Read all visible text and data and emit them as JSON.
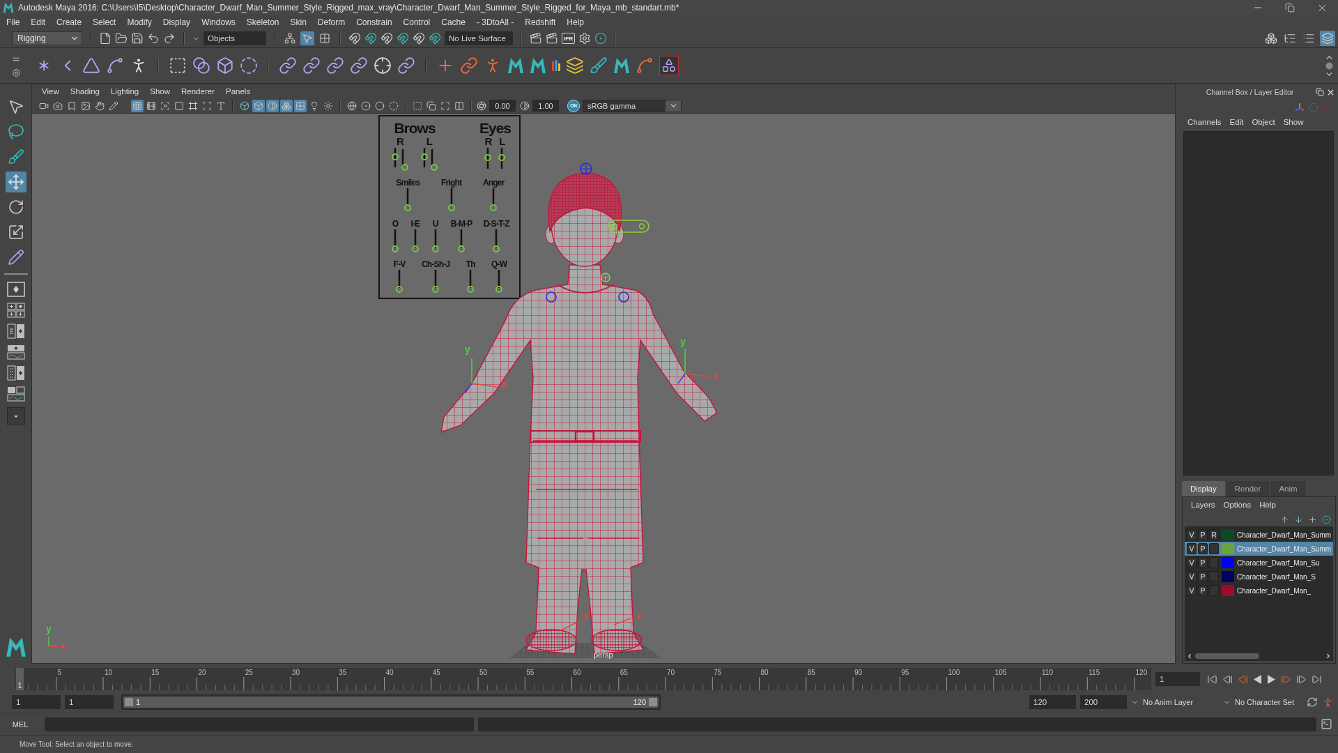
{
  "window": {
    "title": "Autodesk Maya 2016: C:\\Users\\I5\\Desktop\\Character_Dwarf_Man_Summer_Style_Rigged_max_vray\\Character_Dwarf_Man_Summer_Style_Rigged_for_Maya_mb_standart.mb*"
  },
  "menu_bar": [
    "File",
    "Edit",
    "Create",
    "Select",
    "Modify",
    "Display",
    "Windows",
    "Skeleton",
    "Skin",
    "Deform",
    "Constrain",
    "Control",
    "Cache",
    "- 3DtoAll -",
    "Redshift",
    "Help"
  ],
  "status_line": {
    "menu_set": "Rigging",
    "selection_field": "Objects",
    "selection_modes": [
      {
        "kind": "hierarchy",
        "selected": false
      },
      {
        "kind": "object",
        "selected": true
      },
      {
        "kind": "component",
        "selected": false
      }
    ],
    "live_surface": "No Live Surface",
    "ipr_label": "IPR",
    "panel_toggles": [
      {
        "kind": "boxes",
        "selected": false
      },
      {
        "kind": "outline",
        "selected": false
      },
      {
        "kind": "attributes",
        "selected": false
      },
      {
        "kind": "layers",
        "selected": true
      }
    ]
  },
  "toolbox": {
    "tools": [
      {
        "kind": "select",
        "selected": false
      },
      {
        "kind": "lasso",
        "selected": false
      },
      {
        "kind": "paint",
        "selected": false
      },
      {
        "kind": "move",
        "selected": true
      },
      {
        "kind": "rotate",
        "selected": false
      },
      {
        "kind": "scale",
        "selected": false
      },
      {
        "kind": "manipulator",
        "selected": false
      }
    ]
  },
  "viewport": {
    "menu": [
      "View",
      "Shading",
      "Lighting",
      "Show",
      "Renderer",
      "Panels"
    ],
    "toolbar": {
      "groups": [
        [
          {
            "kind": "camera",
            "selected": false
          },
          {
            "kind": "photo",
            "selected": false
          },
          {
            "kind": "bookmark",
            "selected": false
          },
          {
            "kind": "image",
            "selected": false
          },
          {
            "kind": "pan",
            "selected": false
          },
          {
            "kind": "pencil",
            "selected": false
          }
        ],
        [
          {
            "kind": "grid",
            "selected": true
          },
          {
            "kind": "film",
            "selected": false
          },
          {
            "kind": "focus",
            "selected": false
          },
          {
            "kind": "mask",
            "selected": false
          },
          {
            "kind": "frame",
            "selected": false
          },
          {
            "kind": "scan",
            "selected": false
          },
          {
            "kind": "type",
            "selected": false
          }
        ],
        [
          {
            "kind": "wireframe",
            "selected": false
          },
          {
            "kind": "shaded",
            "selected": true
          },
          {
            "kind": "smooth",
            "selected": true
          },
          {
            "kind": "cubes",
            "selected": true
          },
          {
            "kind": "checker",
            "selected": true
          },
          {
            "kind": "light",
            "selected": false
          },
          {
            "kind": "sun",
            "selected": false
          }
        ],
        [
          {
            "kind": "globe",
            "selected": false
          },
          {
            "kind": "target",
            "selected": false
          },
          {
            "kind": "circle",
            "selected": false
          },
          {
            "kind": "dashed",
            "selected": false
          }
        ],
        [
          {
            "kind": "isolate",
            "selected": false
          },
          {
            "kind": "copy",
            "selected": false
          },
          {
            "kind": "maximize",
            "selected": false
          },
          {
            "kind": "columns",
            "selected": false
          }
        ]
      ],
      "exposure": "0.00",
      "gamma": "1.00",
      "color_management": "ON",
      "view_transform": "sRGB gamma"
    },
    "face_board": {
      "sections": [
        {
          "title": "Brows",
          "controls": [
            "R",
            "L"
          ]
        },
        {
          "title": "Eyes",
          "controls": [
            "R",
            "L"
          ]
        }
      ],
      "lines": [
        {
          "controls": [
            "Smiles",
            "Fright",
            "Anger"
          ]
        },
        {
          "controls": [
            "O",
            "I-E",
            "U",
            "B-M-P",
            "D-S-T-Z"
          ]
        },
        {
          "controls": [
            "F-V",
            "Ch-Sh-J",
            "Th",
            "Q-W"
          ]
        }
      ]
    },
    "axis_labels": [
      {
        "text": "y",
        "color": "#46d246"
      },
      {
        "text": "y",
        "color": "#46d246"
      },
      {
        "text": "x",
        "color": "#e8473b"
      },
      {
        "text": "x",
        "color": "#e8473b"
      },
      {
        "text": "x",
        "color": "#e8473b"
      },
      {
        "text": "x",
        "color": "#e8473b"
      },
      {
        "text": "y",
        "color": "#46d246"
      },
      {
        "text": "x",
        "color": "#e8473b"
      }
    ],
    "camera_label": "persp"
  },
  "channel_box": {
    "title": "Channel Box / Layer Editor",
    "menu": [
      "Channels",
      "Edit",
      "Object",
      "Show"
    ]
  },
  "layer_editor": {
    "tabs": [
      {
        "label": "Display",
        "selected": true
      },
      {
        "label": "Render",
        "selected": false
      },
      {
        "label": "Anim",
        "selected": false
      }
    ],
    "menu": [
      "Layers",
      "Options",
      "Help"
    ],
    "layers": [
      {
        "flags": [
          "V",
          "P",
          "R"
        ],
        "color": "#0d4a22",
        "name": "Character_Dwarf_Man_Summ",
        "selected": false
      },
      {
        "flags": [
          "V",
          "P"
        ],
        "color": "#6aa33c",
        "name": "Character_Dwarf_Man_Summ",
        "selected": true
      },
      {
        "flags": [
          "V",
          "P"
        ],
        "color": "#0000ff",
        "name": "Character_Dwarf_Man_Su",
        "selected": false
      },
      {
        "flags": [
          "V",
          "P"
        ],
        "color": "#00005e",
        "name": "Character_Dwarf_Man_S",
        "selected": false
      },
      {
        "flags": [
          "V",
          "P"
        ],
        "color": "#a00a2a",
        "name": "Character_Dwarf_Man_",
        "selected": false
      }
    ]
  },
  "timeline": {
    "ticks": [
      "5",
      "10",
      "15",
      "20",
      "25",
      "30",
      "35",
      "40",
      "45",
      "50",
      "55",
      "60",
      "65",
      "70",
      "75",
      "80",
      "85",
      "90",
      "95",
      "100",
      "105",
      "110",
      "115",
      "120"
    ],
    "current_frame": "1",
    "frame_field": "1"
  },
  "range_slider": {
    "start_time": "1",
    "range_start": "1",
    "level": 1,
    "slider_start": "1",
    "slider_end": "120",
    "range_end": "120",
    "end_time": "200",
    "anim_layer": "No Anim Layer",
    "character_set": "No Character Set"
  },
  "command_line": {
    "language": "MEL"
  },
  "help_line": "Move Tool: Select an object to move."
}
